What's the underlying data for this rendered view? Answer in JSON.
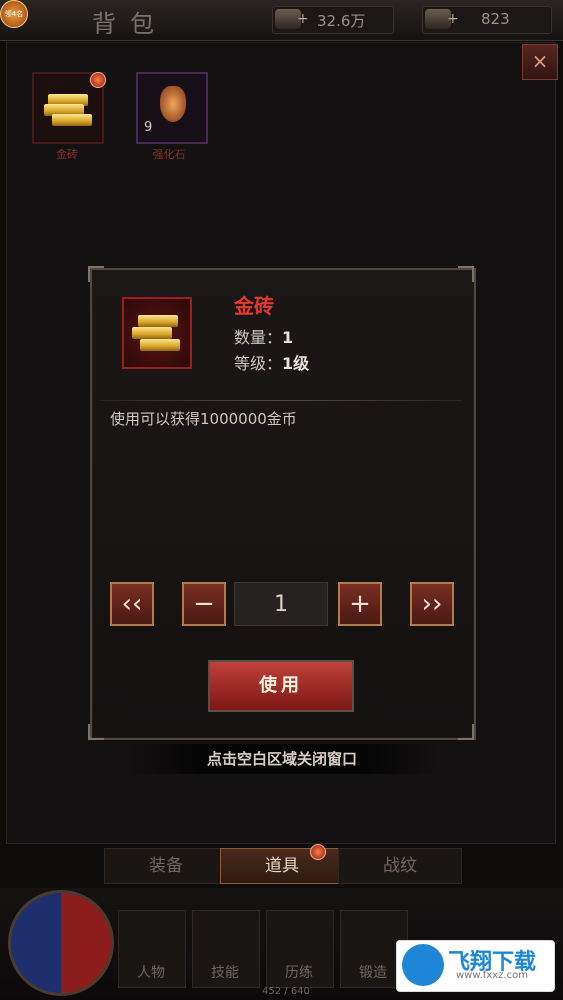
{
  "header": {
    "title": "背包",
    "avatar_badge": "领4名",
    "resources": [
      {
        "icon": "silver-coin-icon",
        "value": "32.6万"
      },
      {
        "icon": "gold-ingot-icon",
        "value": "823"
      }
    ]
  },
  "bag": {
    "slots": [
      {
        "label": "金砖",
        "count": ""
      },
      {
        "label": "强化石",
        "count": "9"
      }
    ],
    "close_label": "×"
  },
  "modal": {
    "item_name": "金砖",
    "quantity_label": "数量：",
    "quantity_value": "1",
    "level_label": "等级：",
    "level_value": "1级",
    "description": "使用可以获得1000000金币",
    "stepper": {
      "min_label": "‹‹",
      "minus_label": "−",
      "value": "1",
      "plus_label": "+",
      "max_label": "››"
    },
    "use_label": "使用"
  },
  "hint": "点击空白区域关闭窗口",
  "tabs": [
    {
      "label": "装备",
      "active": false
    },
    {
      "label": "道具",
      "active": true
    },
    {
      "label": "战纹",
      "active": false
    }
  ],
  "nav": [
    {
      "label": "人物"
    },
    {
      "label": "技能"
    },
    {
      "label": "历练"
    },
    {
      "label": "锻造"
    }
  ],
  "exp": "452 / 640",
  "watermark": {
    "title": "飞翔下载",
    "url": "www.fxxz.com"
  },
  "colors": {
    "item_name": "#e23a2e",
    "use_button": "#c0403a"
  }
}
